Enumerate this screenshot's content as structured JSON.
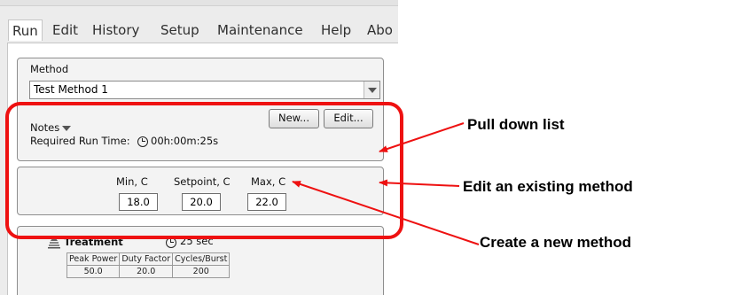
{
  "menu": {
    "items": [
      {
        "label": "Run"
      },
      {
        "label": "Edit"
      },
      {
        "label": "History"
      },
      {
        "label": "Setup"
      },
      {
        "label": "Maintenance"
      },
      {
        "label": "Help"
      },
      {
        "label": "Abo"
      }
    ],
    "active": "Run"
  },
  "method": {
    "label": "Method",
    "selected": "Test Method 1",
    "notes_label": "Notes",
    "required_run_time_label": "Required Run Time:",
    "required_run_time_value": "00h:00m:25s",
    "new_button": "New...",
    "edit_button": "Edit..."
  },
  "temperature": {
    "min_label": "Min, C",
    "setpoint_label": "Setpoint, C",
    "max_label": "Max, C",
    "min_value": "18.0",
    "setpoint_value": "20.0",
    "max_value": "22.0"
  },
  "treatment": {
    "title": "Treatment",
    "duration": "25 sec",
    "columns": [
      "Peak Power",
      "Duty Factor",
      "Cycles/Burst"
    ],
    "values": [
      "50.0",
      "20.0",
      "200"
    ]
  },
  "annotations": {
    "pull_down": "Pull down list",
    "edit_existing": "Edit an existing method",
    "create_new": "Create a new method"
  },
  "colors": {
    "annotation_red": "#ee1111",
    "panel_border": "#8e8e8e",
    "window_bg": "#ececec"
  }
}
